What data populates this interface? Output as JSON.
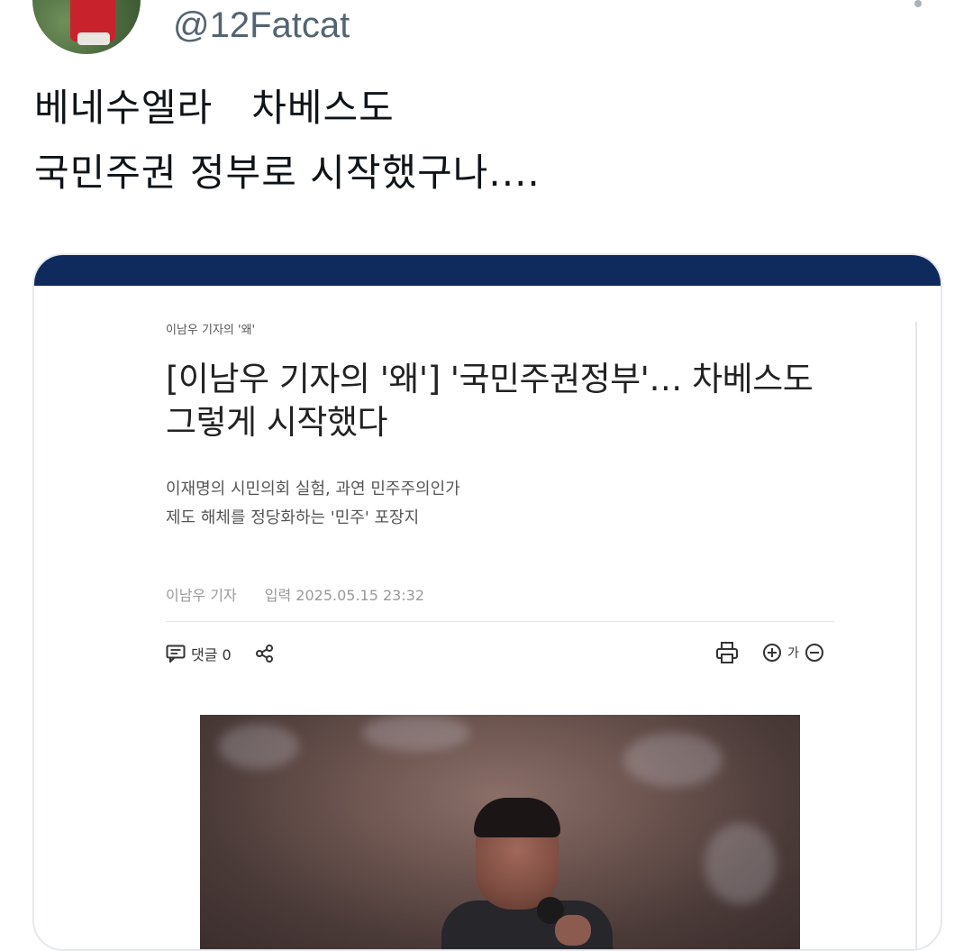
{
  "tweet": {
    "handle": "@12Fatcat",
    "text_line1": "베네수엘라   차베스도",
    "text_line2": "국민주권 정부로 시작했구나....",
    "avatar_icon": "profile-photo"
  },
  "article_card": {
    "kicker": "이남우 기자의 '왜'",
    "headline_line1": "[이남우 기자의 '왜'] '국민주권정부'… 차베스도",
    "headline_line2": "그렇게 시작했다",
    "subhead_line1": "이재명의 시민의회 실험, 과연 민주주의인가",
    "subhead_line2": "제도 해체를 정당화하는 '민주' 포장지",
    "author": "이남우 기자",
    "date_label": "입력 2025.05.15 23:32",
    "comment_label": "댓글 0",
    "font_size_label": "가",
    "icons": {
      "comment": "comment-icon",
      "share": "share-icon",
      "print": "print-icon",
      "zoom_in": "zoom-in-icon",
      "zoom_out": "zoom-out-icon"
    },
    "colors": {
      "header_band": "#0f2a5c"
    }
  }
}
